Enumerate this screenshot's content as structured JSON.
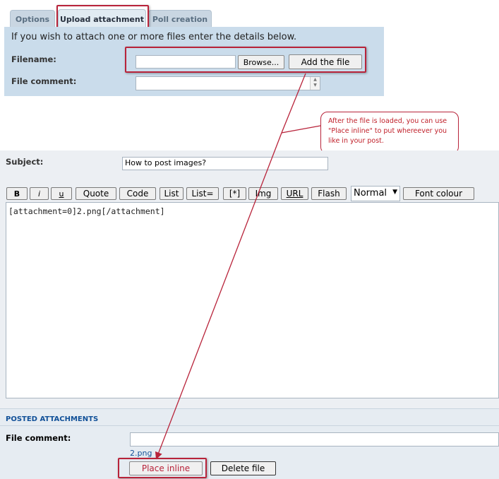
{
  "tabs": [
    {
      "label": "Options"
    },
    {
      "label": "Upload attachment"
    },
    {
      "label": "Poll creation"
    }
  ],
  "upload": {
    "intro": "If you wish to attach one or more files enter the details below.",
    "filename_label": "Filename:",
    "browse_label": "Browse...",
    "add_file_label": "Add the file",
    "file_comment_label": "File comment:"
  },
  "callout": {
    "text": "After the file is loaded, you can use \"Place inline\" to put whereever you like in your post."
  },
  "post": {
    "subject_label": "Subject:",
    "subject_value": "How to post images?",
    "toolbar": {
      "bold": "B",
      "italic": "i",
      "underline": "u",
      "quote": "Quote",
      "code": "Code",
      "list": "List",
      "list_eq": "List=",
      "list_item": "[*]",
      "img": "Img",
      "url": "URL",
      "flash": "Flash",
      "font_size": "Normal",
      "font_colour": "Font colour"
    },
    "message": "[attachment=0]2.png[/attachment]"
  },
  "attachments": {
    "heading": "POSTED ATTACHMENTS",
    "file_comment_label": "File comment:",
    "file_name": "2.png",
    "place_inline_label": "Place inline",
    "delete_label": "Delete file"
  },
  "colors": {
    "panel_bg": "#cadceb",
    "annotation_red": "#b8233a",
    "heading_blue": "#115098"
  }
}
